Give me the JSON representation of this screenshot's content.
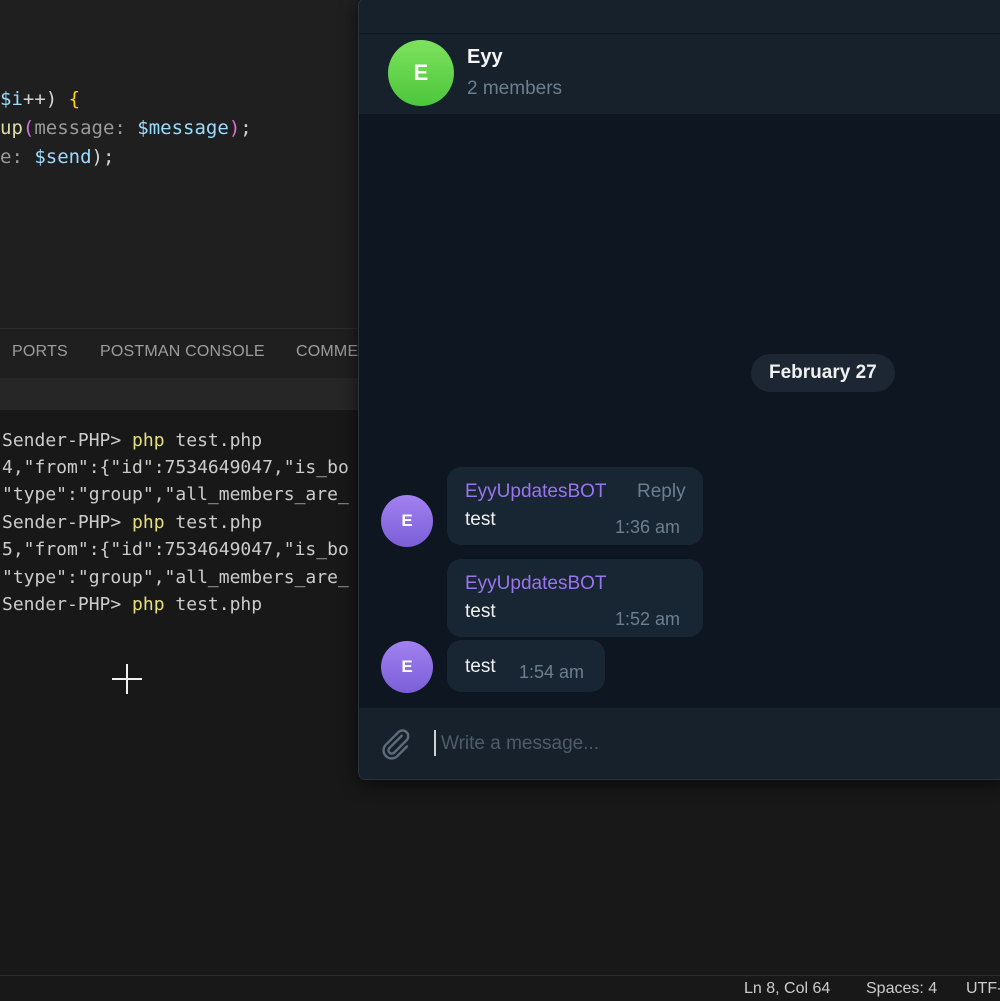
{
  "editor": {
    "lines": [
      {
        "parts": [
          [
            "",
            "c-op"
          ],
          [
            "$i",
            "c-var"
          ],
          [
            "++) ",
            "c-op"
          ],
          [
            "{",
            "c-brace"
          ]
        ]
      },
      {
        "parts": [
          [
            "up",
            "c-fn"
          ],
          [
            "(",
            "c-paren"
          ],
          [
            "message: ",
            "c-param"
          ],
          [
            "$message",
            "c-var"
          ],
          [
            ")",
            "c-paren"
          ],
          [
            ";",
            "c-op"
          ]
        ]
      },
      {
        "parts": [
          [
            "e: ",
            "c-param"
          ],
          [
            "$send",
            "c-var"
          ],
          [
            ");",
            "c-op"
          ]
        ]
      }
    ]
  },
  "panel": {
    "tabs": [
      "PORTS",
      "POSTMAN CONSOLE",
      "COMME"
    ]
  },
  "terminal": {
    "lines": [
      {
        "prefix": "Sender-PHP> ",
        "cmd": "php",
        "rest": " test.php"
      },
      {
        "prefix": "4,\"from\":{\"id\":7534649047,\"is_bo",
        "cmd": "",
        "rest": ""
      },
      {
        "prefix": "\"type\":\"group\",\"all_members_are_",
        "cmd": "",
        "rest": ""
      },
      {
        "prefix": "Sender-PHP> ",
        "cmd": "php",
        "rest": " test.php"
      },
      {
        "prefix": "5,\"from\":{\"id\":7534649047,\"is_bo",
        "cmd": "",
        "rest": ""
      },
      {
        "prefix": "\"type\":\"group\",\"all_members_are_",
        "cmd": "",
        "rest": ""
      },
      {
        "prefix": "Sender-PHP> ",
        "cmd": "php",
        "rest": " test.php"
      }
    ]
  },
  "statusbar": {
    "position": "Ln 8, Col 64",
    "spaces": "Spaces: 4",
    "encoding": "UTF-"
  },
  "telegram": {
    "chat": {
      "avatar_letter": "E",
      "title": "Eyy",
      "subtitle": "2 members"
    },
    "date_label": "February 27",
    "messages": [
      {
        "sender": "EyyUpdatesBOT",
        "reply": "Reply",
        "text": "test",
        "time": "1:36 am",
        "avatar": "E"
      },
      {
        "sender": "EyyUpdatesBOT",
        "text": "test",
        "time": "1:52 am"
      },
      {
        "text": "test",
        "time": "1:54 am",
        "avatar": "E"
      }
    ],
    "input": {
      "placeholder": "Write a message..."
    },
    "colors": {
      "group_avatar": "#5dd34a",
      "bot_avatar": "#8c6be6",
      "sender_name": "#9b74f0",
      "background": "#0e1621",
      "bubble": "#182533"
    }
  }
}
